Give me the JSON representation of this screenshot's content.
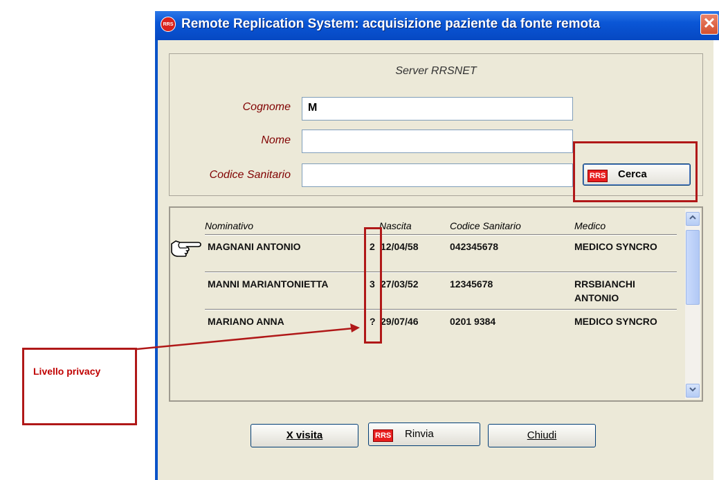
{
  "window": {
    "title": "Remote Replication System: acquisizione paziente da fonte remota",
    "app_icon_text": "RRS",
    "close_glyph": "✕"
  },
  "search": {
    "server_title": "Server RRSNET",
    "cognome_label": "Cognome",
    "cognome_value": "M",
    "nome_label": "Nome",
    "nome_value": "",
    "codice_label": "Codice Sanitario",
    "codice_value": "",
    "cerca_icon_text": "RRS",
    "cerca_label": "Cerca"
  },
  "list": {
    "headers": {
      "nominativo": "Nominativo",
      "nascita": "Nascita",
      "codice": "Codice Sanitario",
      "medico": "Medico"
    },
    "pointer_icon": "pointing-hand-icon",
    "rows": [
      {
        "name": "MAGNANI ANTONIO",
        "privacy": "2",
        "birth": "12/04/58",
        "code": "042345678",
        "doctor": "MEDICO SYNCRO"
      },
      {
        "name": "MANNI MARIANTONIETTA",
        "privacy": "3",
        "birth": "27/03/52",
        "code": "12345678",
        "doctor": "RRSBIANCHI ANTONIO"
      },
      {
        "name": "MARIANO ANNA",
        "privacy": "?",
        "birth": "29/07/46",
        "code": "0201 9384",
        "doctor": "MEDICO SYNCRO"
      }
    ]
  },
  "buttons": {
    "xvisita_label": "X visita",
    "rinvia_icon_text": "RRS",
    "rinvia_label": "Rinvia",
    "chiudi_label": "Chiudi"
  },
  "annotation": {
    "label": "Livello privacy"
  },
  "colors": {
    "titlebar": "#0A56D6",
    "window_bg": "#ECE9D8",
    "label_text": "#800000",
    "annotation_red": "#B01818"
  }
}
